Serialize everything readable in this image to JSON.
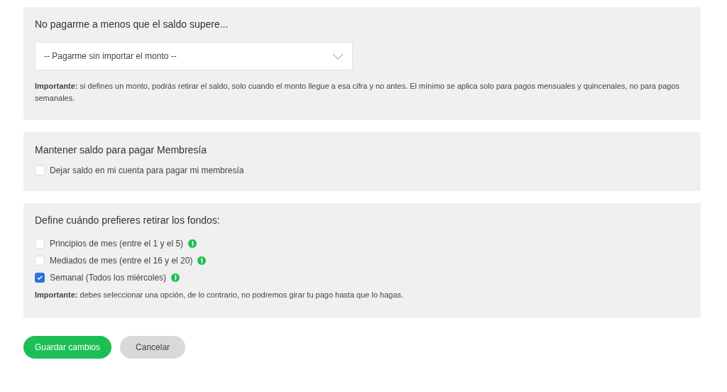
{
  "threshold_section": {
    "title": "No pagarme a menos que el saldo supere...",
    "select": {
      "value": "-- Pagarme sin importar el monto --"
    },
    "note": "**Importante:** si defines un monto, podrás retirar el saldo, solo cuando el monto llegue a esa cifra y no antes. El mínimo se aplica solo para pagos mensuales y quincenales, no para pagos semanales."
  },
  "membership_section": {
    "title": "Mantener saldo para pagar Membresía",
    "options": [
      {
        "label": "Dejar saldo en mi cuenta para pagar mi membresía",
        "checked": false,
        "info": false
      }
    ]
  },
  "schedule_section": {
    "title": "Define cuándo prefieres retirar los fondos:",
    "options": [
      {
        "label": "Principios de mes (entre el 1 y el 5)",
        "checked": false,
        "info": true
      },
      {
        "label": "Mediados de mes (entre el 16 y el 20)",
        "checked": false,
        "info": true
      },
      {
        "label": "Semanal (Todos los miércoles)",
        "checked": true,
        "info": true
      }
    ],
    "note": "**Importante:** debes seleccionar una opción, de lo contrario, no podremos girar tu pago hasta que lo hagas."
  },
  "buttons": [
    {
      "label": "Guardar cambios",
      "kind": "primary"
    },
    {
      "label": "Cancelar",
      "kind": "secondary"
    }
  ]
}
